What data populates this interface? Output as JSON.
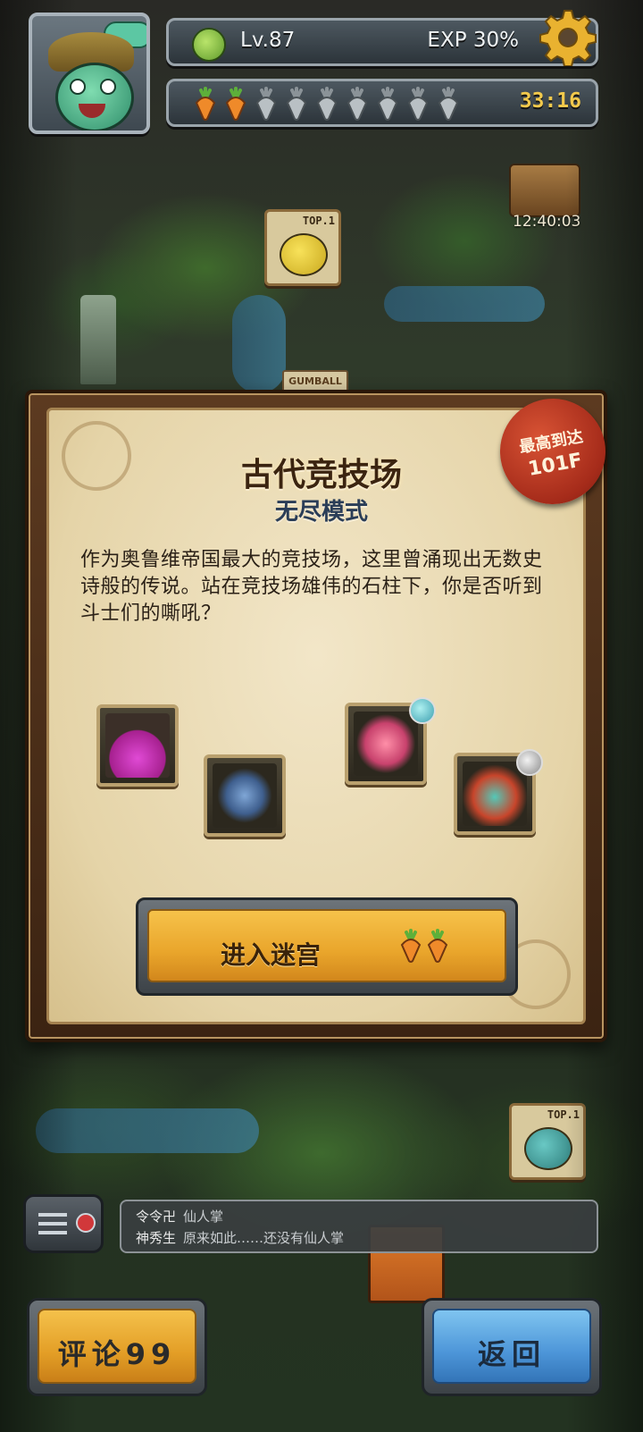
{
  "hud": {
    "level": "Lv.87",
    "exp": "EXP 30%",
    "stamina": {
      "filled": 2,
      "total": 9,
      "timer": "33:16"
    }
  },
  "map": {
    "chest_timer": "12:40:03",
    "rank_badges": [
      "TOP.1",
      "TOP.1"
    ],
    "sign": "GUMBALL"
  },
  "dungeon": {
    "title": "古代竞技场",
    "mode": "无尽模式",
    "record": {
      "label": "最高到达",
      "floor": "101F"
    },
    "description": "作为奥鲁维帝国最大的竞技场，这里曾涌现出无数史诗般的传说。站在竞技场雄伟的石柱下，你是否听到斗士们的嘶吼？",
    "rewards": [
      "potion-icon",
      "harp-icon"
    ],
    "bosses": [
      "crab-boss-icon",
      "warrior-boss-icon"
    ],
    "enter_label": "进入迷宫",
    "enter_cost": 2
  },
  "chat": {
    "messages": [
      {
        "user": "令令卍",
        "text": "仙人掌"
      },
      {
        "user": "神秀生",
        "text": "原来如此……还没有仙人掌"
      }
    ]
  },
  "buttons": {
    "comment": "评论99",
    "back": "返回"
  },
  "colors": {
    "gold_button": "#e9a52b",
    "blue_button": "#4c95d8",
    "seal": "#a52b1a",
    "timer": "#f2c94c"
  }
}
